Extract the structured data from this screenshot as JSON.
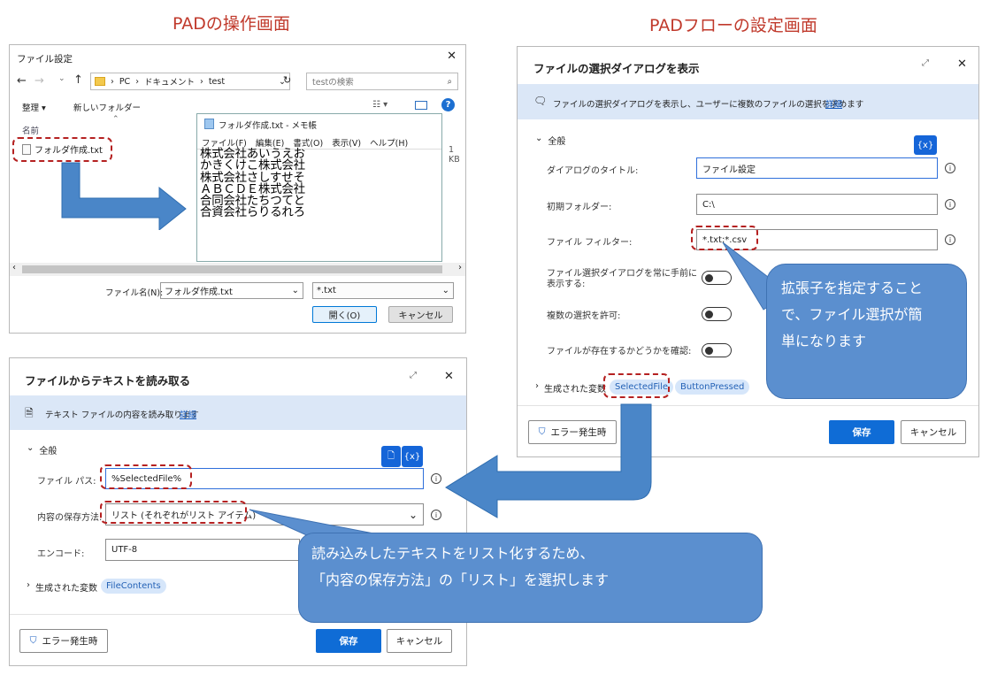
{
  "headings": {
    "left": "PADの操作画面",
    "right": "PADフローの設定画面"
  },
  "file_dialog": {
    "title": "ファイル設定",
    "close_glyph": "✕",
    "path": [
      "PC",
      "ドキュメント",
      "test"
    ],
    "search_placeholder": "testの検索",
    "toolbar_organize": "整理 ▾",
    "toolbar_new_folder": "新しいフォルダー",
    "column_name": "名前",
    "file_name": "フォルダ作成.txt",
    "size_text": "1 KB",
    "filename_label": "ファイル名(N):",
    "filename_value": "フォルダ作成.txt",
    "filter_value": "*.txt",
    "open_button": "開く(O)",
    "cancel_button": "キャンセル"
  },
  "notepad": {
    "title": "フォルダ作成.txt - メモ帳",
    "menu": [
      "ファイル(F)",
      "編集(E)",
      "書式(O)",
      "表示(V)",
      "ヘルプ(H)"
    ],
    "lines": [
      "株式会社あいうえお",
      "かきくけこ株式会社",
      "株式会社さしすせそ",
      "ＡＢＣＤＥ株式会社",
      "合同会社たちつてと",
      "合資会社らりるれろ"
    ]
  },
  "select_dialog": {
    "title": "ファイルの選択ダイアログを表示",
    "description": "ファイルの選択ダイアログを表示し、ユーザーに複数のファイルの選択を求めます",
    "details_link": "詳細",
    "section": "全般",
    "var_badge": "{x}",
    "fields": {
      "title_label": "ダイアログのタイトル:",
      "title_value": "ファイル設定",
      "folder_label": "初期フォルダー:",
      "folder_value": "C:\\",
      "filter_label": "ファイル フィルター:",
      "filter_value": "*.txt;*.csv",
      "topmost_label": "ファイル選択ダイアログを常に手前に表示する:",
      "multi_label": "複数の選択を許可:",
      "exists_label": "ファイルが存在するかどうかを確認:"
    },
    "generated_label": "生成された変数",
    "generated_vars": [
      "SelectedFile",
      "ButtonPressed"
    ],
    "error_button": "エラー発生時",
    "save_button": "保存",
    "cancel_button": "キャンセル"
  },
  "read_dialog": {
    "title": "ファイルからテキストを読み取る",
    "description": "テキスト ファイルの内容を読み取ります",
    "details_link": "詳細",
    "section": "全般",
    "var_badge": "{x}",
    "fields": {
      "path_label": "ファイル パス:",
      "path_value": "%SelectedFile%",
      "store_label": "内容の保存方法:",
      "store_value": "リスト (それぞれがリスト アイテム)",
      "encoding_label": "エンコード:",
      "encoding_value": "UTF-8"
    },
    "generated_label": "生成された変数",
    "generated_vars": [
      "FileContents"
    ],
    "error_button": "エラー発生時",
    "save_button": "保存",
    "cancel_button": "キャンセル"
  },
  "callouts": {
    "filter_note": [
      "拡張子を指定すること",
      "で、ファイル選択が簡",
      "単になります"
    ],
    "list_note": [
      "読み込みしたテキストをリスト化するため、",
      "「内容の保存方法」の「リスト」を選択します"
    ]
  },
  "colors": {
    "heading": "#c0392b",
    "callout": "#5b8fcf",
    "arrow": "#4a86c8",
    "dash": "#b52121",
    "primary": "#0f6cd6"
  }
}
